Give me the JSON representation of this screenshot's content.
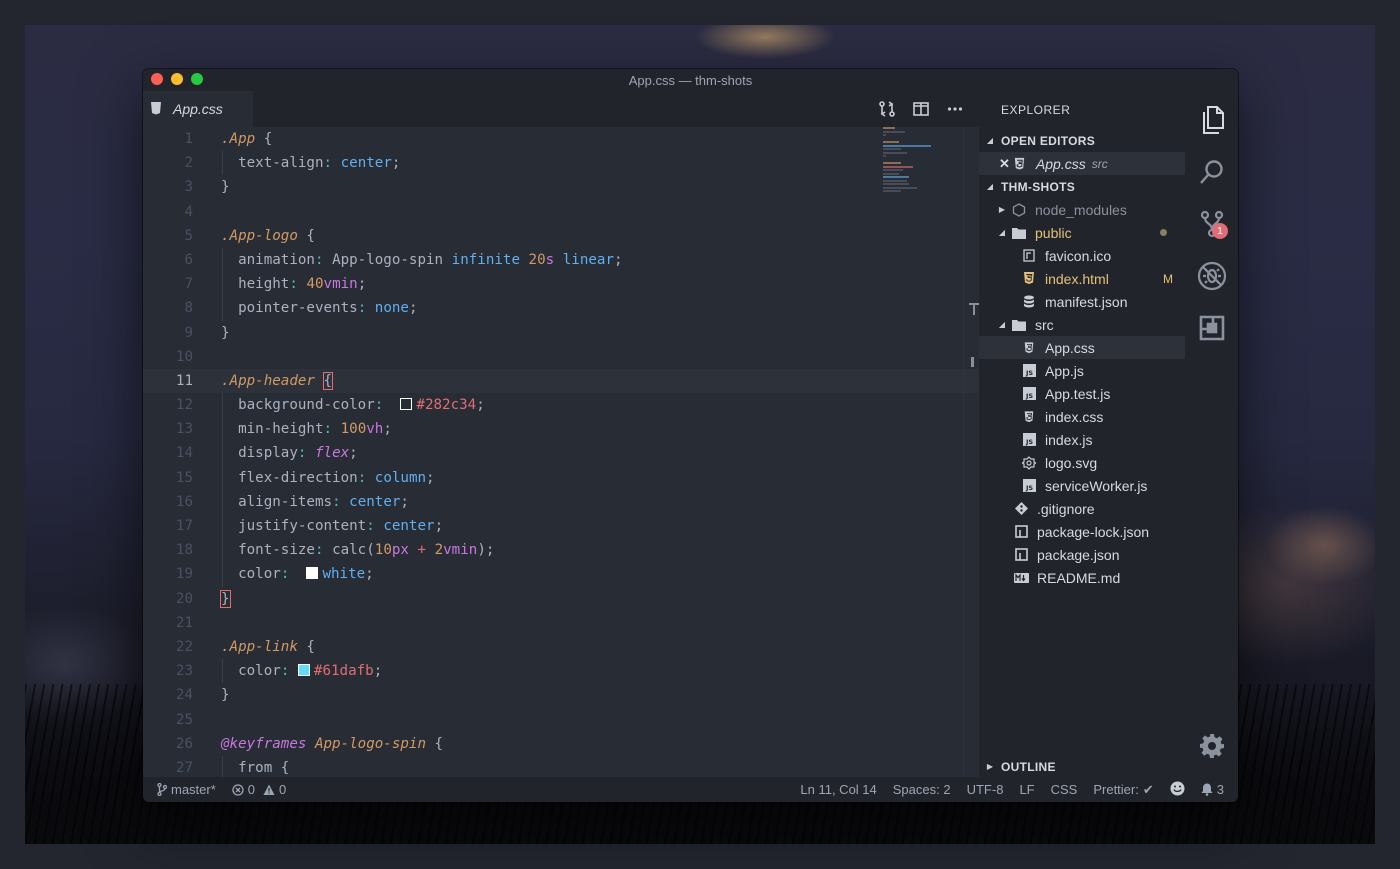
{
  "window": {
    "title": "App.css — thm-shots"
  },
  "tab": {
    "label": "App.css"
  },
  "editor": {
    "lines": [
      {
        "n": "1"
      },
      {
        "n": "2"
      },
      {
        "n": "3"
      },
      {
        "n": "4"
      },
      {
        "n": "5"
      },
      {
        "n": "6"
      },
      {
        "n": "7"
      },
      {
        "n": "8"
      },
      {
        "n": "9"
      },
      {
        "n": "10"
      },
      {
        "n": "11"
      },
      {
        "n": "12"
      },
      {
        "n": "13"
      },
      {
        "n": "14"
      },
      {
        "n": "15"
      },
      {
        "n": "16"
      },
      {
        "n": "17"
      },
      {
        "n": "18"
      },
      {
        "n": "19"
      },
      {
        "n": "20"
      },
      {
        "n": "21"
      },
      {
        "n": "22"
      },
      {
        "n": "23"
      },
      {
        "n": "24"
      },
      {
        "n": "25"
      },
      {
        "n": "26"
      },
      {
        "n": "27"
      }
    ],
    "code": {
      "l1_sel": ".App",
      "l1_rest": " {",
      "l2_prop": "text-align",
      "l2_val": "center",
      "l3": "}",
      "l5_sel": ".App-logo",
      "l5_rest": " {",
      "l6_prop": "animation",
      "l6_name": "App-logo-spin",
      "l6_inf": "infinite",
      "l6_num": "20",
      "l6_unit": "s",
      "l6_lin": "linear",
      "l7_prop": "height",
      "l7_num": "40",
      "l7_unit": "vmin",
      "l8_prop": "pointer-events",
      "l8_val": "none",
      "l9": "}",
      "l11_sel": ".App-header",
      "l11_brace": "{",
      "l12_prop": "background-color",
      "l12_hex": "#282c34",
      "l13_prop": "min-height",
      "l13_num": "100",
      "l13_unit": "vh",
      "l14_prop": "display",
      "l14_val": "flex",
      "l15_prop": "flex-direction",
      "l15_val": "column",
      "l16_prop": "align-items",
      "l16_val": "center",
      "l17_prop": "justify-content",
      "l17_val": "center",
      "l18_prop": "font-size",
      "l18_fn": "calc(",
      "l18_num1": "10",
      "l18_unit1": "px",
      "l18_op": " + ",
      "l18_num2": "2",
      "l18_unit2": "vmin",
      "l18_close": ")",
      "l19_prop": "color",
      "l19_val": "white",
      "l20": "}",
      "l22_sel": ".App-link",
      "l22_rest": " {",
      "l23_prop": "color",
      "l23_hex": "#61dafb",
      "l24": "}",
      "l26_at": "@keyframes",
      "l26_name": "App-logo-spin",
      "l26_rest": " {",
      "l27": "from {"
    },
    "punct": {
      "colon": ":",
      "semi": ";",
      "space": " "
    }
  },
  "explorer": {
    "title": "EXPLORER",
    "open_editors": "OPEN EDITORS",
    "open_file": "App.css",
    "open_file_dir": "src",
    "project": "THM-SHOTS",
    "items": {
      "node_modules": "node_modules",
      "public": "public",
      "favicon": "favicon.ico",
      "index_html": "index.html",
      "index_html_badge": "M",
      "manifest": "manifest.json",
      "src": "src",
      "app_css": "App.css",
      "app_js": "App.js",
      "app_test": "App.test.js",
      "index_css": "index.css",
      "index_js": "index.js",
      "logo": "logo.svg",
      "sw": "serviceWorker.js",
      "gitignore": ".gitignore",
      "pkg_lock": "package-lock.json",
      "pkg": "package.json",
      "readme": "README.md"
    },
    "outline": "OUTLINE"
  },
  "activity": {
    "scm_badge": "1"
  },
  "status": {
    "branch": "master*",
    "errors": "0",
    "warnings": "0",
    "position": "Ln 11, Col 14",
    "spaces": "Spaces: 2",
    "encoding": "UTF-8",
    "eol": "LF",
    "language": "CSS",
    "prettier": "Prettier:",
    "prettier_check": "✔",
    "bell_count": "3"
  },
  "colors": {
    "editor_bg": "#282c34",
    "sidebar_bg": "#21252b",
    "selector": "#d19a66",
    "value": "#61afef",
    "unit": "#c678dd",
    "hex": "#e06c75",
    "modified": "#e5c07b",
    "badge": "#e06c75"
  }
}
